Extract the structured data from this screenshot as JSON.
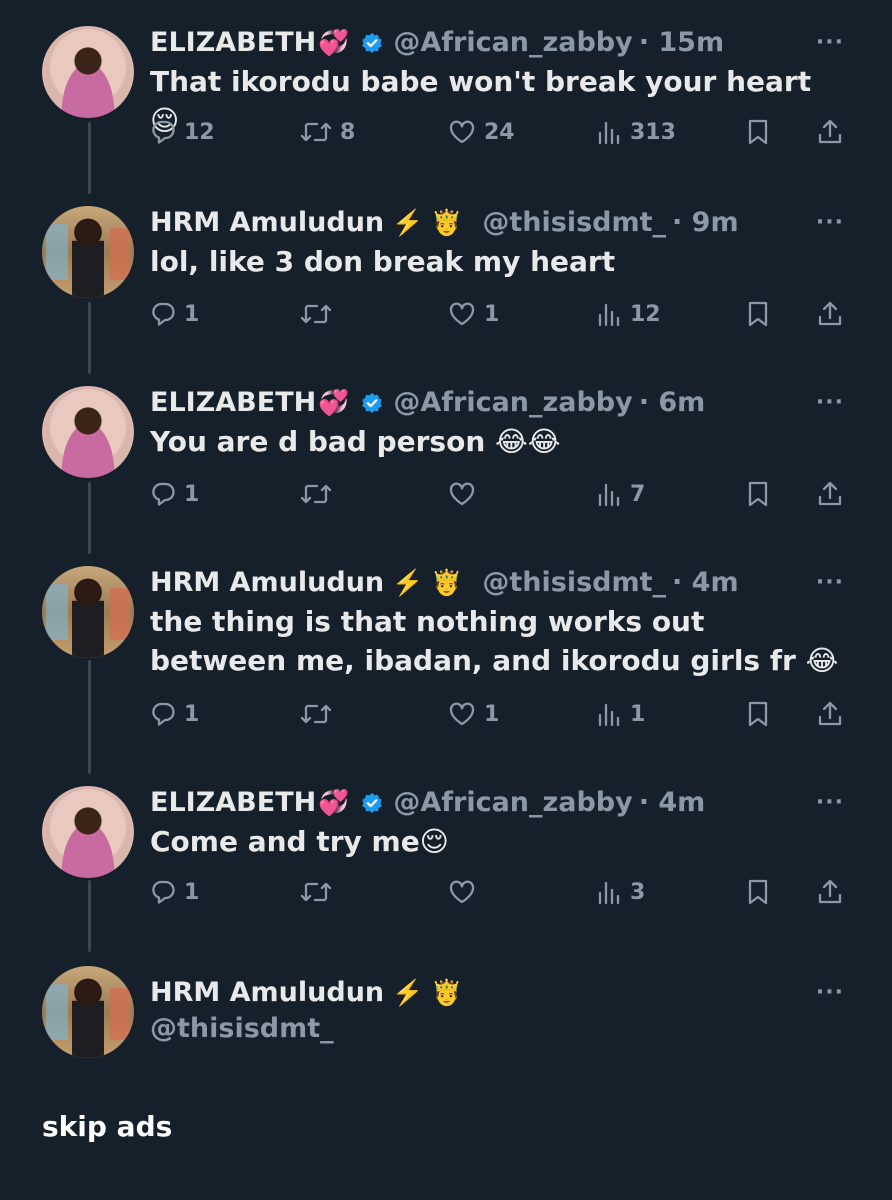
{
  "tweets": [
    {
      "name": "ELIZABETH",
      "name_emoji": "💞",
      "verified": true,
      "handle": "@African_zabby",
      "time": "· 15m",
      "text": "That ikorodu babe won't break your heart😌",
      "replies": "12",
      "retweets": "8",
      "likes": "24",
      "views": "313",
      "avatar": "woman"
    },
    {
      "name": "HRM Amuludun",
      "name_emoji": "⚡️ 🤴",
      "verified": false,
      "handle": "@thisisdmt_",
      "time": "· 9m",
      "text": "lol, like 3 don break my heart",
      "replies": "1",
      "retweets": "",
      "likes": "1",
      "views": "12",
      "avatar": "man"
    },
    {
      "name": "ELIZABETH",
      "name_emoji": "💞",
      "verified": true,
      "handle": "@African_zabby",
      "time": "· 6m",
      "text": "You are d bad person 😂😂",
      "replies": "1",
      "retweets": "",
      "likes": "",
      "views": "7",
      "avatar": "woman"
    },
    {
      "name": "HRM Amuludun",
      "name_emoji": "⚡️ 🤴",
      "verified": false,
      "handle": "@thisisdmt_",
      "time": "· 4m",
      "text": "the thing is that nothing works out between me, ibadan, and ikorodu girls fr 😂",
      "replies": "1",
      "retweets": "",
      "likes": "1",
      "views": "1",
      "avatar": "man"
    },
    {
      "name": "ELIZABETH",
      "name_emoji": "💞",
      "verified": true,
      "handle": "@African_zabby",
      "time": "· 4m",
      "text": "Come and try me😌",
      "replies": "1",
      "retweets": "",
      "likes": "",
      "views": "3",
      "avatar": "woman"
    }
  ],
  "composer": {
    "name": "HRM Amuludun",
    "name_emoji": "⚡️ 🤴",
    "handle": "@thisisdmt_",
    "avatar": "man"
  },
  "more_label": "···",
  "footer_text": "skip ads",
  "colors": {
    "background": "#15202b",
    "text": "#e7e9ea",
    "muted": "#8b98a5",
    "verified": "#1d9bf0",
    "connector": "#3b4751"
  },
  "icons": [
    "reply-icon",
    "retweet-icon",
    "like-icon",
    "views-icon",
    "bookmark-icon",
    "share-icon",
    "verified-badge-icon",
    "more-icon"
  ]
}
